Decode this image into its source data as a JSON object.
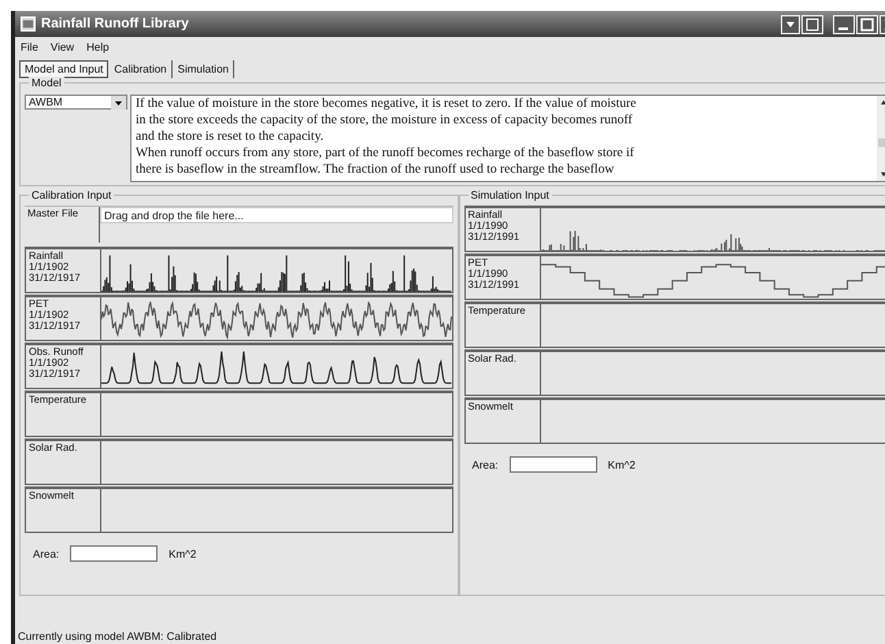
{
  "window": {
    "title": "Rainfall Runoff Library"
  },
  "menu": [
    "File",
    "View",
    "Help"
  ],
  "tabs": [
    {
      "label": "Model and Input",
      "selected": true
    },
    {
      "label": "Calibration",
      "selected": false
    },
    {
      "label": "Simulation",
      "selected": false
    }
  ],
  "model": {
    "title": "Model",
    "value": "AWBM",
    "description": [
      "If the value of moisture in the store becomes negative, it is reset to zero.  If the value of moisture",
      "in the store exceeds the capacity of the store, the moisture in excess of capacity becomes runoff",
      "and the store is reset to the capacity.",
      "When runoff occurs from any store, part of the runoff becomes recharge of the baseflow store if",
      "there is baseflow in the streamflow.  The fraction of the runoff used to recharge the baseflow"
    ]
  },
  "calibration_input": {
    "title": "Calibration Input",
    "rows": [
      {
        "kind": "file",
        "label": [
          "Master File"
        ],
        "placeholder": "Drag and drop the file here..."
      },
      {
        "kind": "bars",
        "label": [
          "Rainfall",
          "1/1/1902",
          "31/12/1917"
        ]
      },
      {
        "kind": "wave",
        "label": [
          "PET",
          "1/1/1902",
          "31/12/1917"
        ]
      },
      {
        "kind": "hydrograph",
        "label": [
          "Obs. Runoff",
          "1/1/1902",
          "31/12/1917"
        ]
      },
      {
        "kind": "empty",
        "label": [
          "Temperature"
        ]
      },
      {
        "kind": "empty",
        "label": [
          "Solar  Rad."
        ]
      },
      {
        "kind": "empty",
        "label": [
          "Snowmelt"
        ]
      }
    ],
    "area_label": "Area:",
    "area_unit": "Km^2"
  },
  "simulation_input": {
    "title": "Simulation Input",
    "rows": [
      {
        "kind": "sparse",
        "label": [
          "Rainfall",
          "1/1/1990",
          "31/12/1991"
        ]
      },
      {
        "kind": "steps",
        "label": [
          "PET",
          "1/1/1990",
          "31/12/1991"
        ]
      },
      {
        "kind": "empty",
        "label": [
          "Temperature"
        ]
      },
      {
        "kind": "empty",
        "label": [
          "Solar Rad."
        ]
      },
      {
        "kind": "empty",
        "label": [
          "Snowmelt"
        ]
      }
    ],
    "area_label": "Area:",
    "area_unit": "Km^2"
  },
  "status_bar": "Currently using model AWBM: Calibrated"
}
